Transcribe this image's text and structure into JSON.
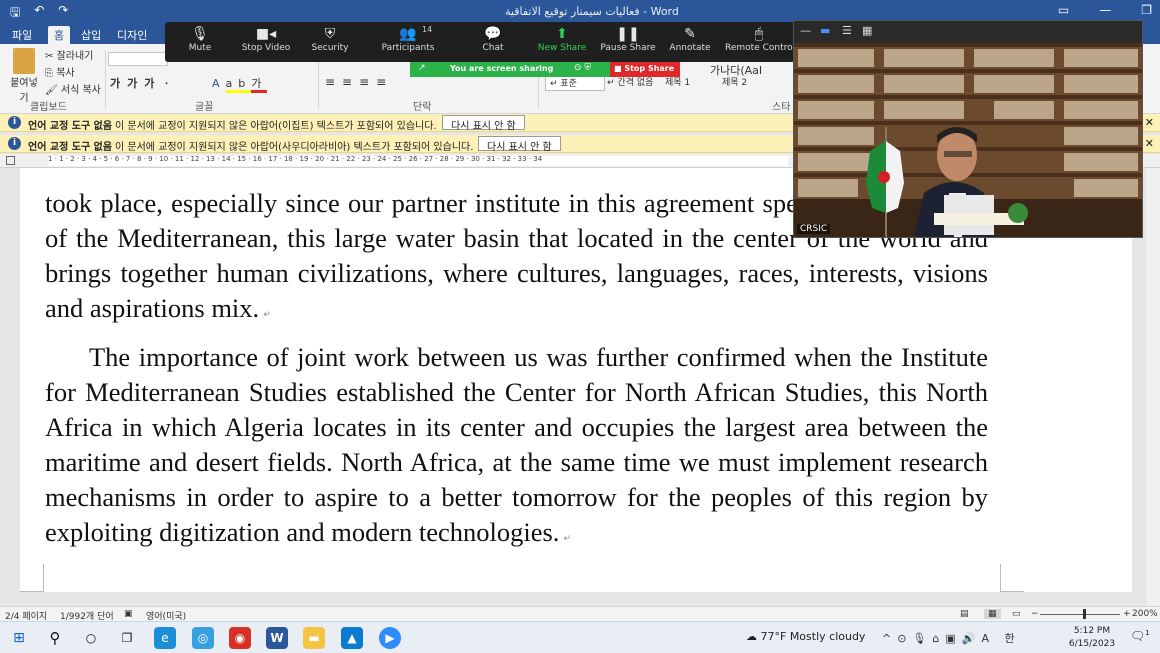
{
  "titlebar": {
    "doc_title": "فعاليات سيمنار توقيع الاتفاقية - Word"
  },
  "ribbon_tabs": [
    {
      "label": "파일"
    },
    {
      "label": "홈"
    },
    {
      "label": "삽입"
    },
    {
      "label": "디자인"
    }
  ],
  "ribbon": {
    "clipboard": {
      "paste": "붙여넣기",
      "cut": "잘라내기",
      "copy": "복사",
      "format_painter": "서식 복사",
      "group": "클립보드"
    },
    "font_group": "글꼴",
    "paragraph_group": "단락",
    "styles": {
      "sample": "가나다(AaI",
      "heading1": "제목 1",
      "heading2": "제목 2",
      "standard": "↵ 표준",
      "no_spacing": "↵ 간격 없음",
      "group": "스타"
    }
  },
  "infobars": [
    {
      "bold": "언어 교정 도구 없음",
      "message": "이 문서에 교정이 지원되지 않은 아랍어(이집트) 텍스트가 포함되어 있습니다.",
      "button": "다시 표시 안 함"
    },
    {
      "bold": "언어 교정 도구 없음",
      "message": "이 문서에 교정이 지원되지 않은 아랍어(사우디아라비아) 텍스트가 포함되어 있습니다.",
      "button": "다시 표시 안 함"
    }
  ],
  "ruler": {
    "numbers": "1 · 1 · 2 · 3 · 4 · 5 · 6 · 7 · 8 · 9 · 10 · 11 · 12 · 13 · 14 · 15 · 16 · 17 · 18 · 19 · 20 · 21 · 22 · 23 · 24 · 25 · 26 · 27 · 28 · 29 · 30 · 31 · 32 · 33 · 34"
  },
  "document": {
    "paragraph1": "took place, especially since our partner institute in this agreement specializes in studies of the Mediterranean, this large water basin that located in the center of the world and brings together human civilizations, where cultures, languages, races, interests, visions and aspirations mix.",
    "paragraph2": "The importance of joint work between us was further confirmed when the Institute for Mediterranean Studies established the Center for North African Studies, this North Africa in which Algeria locates in its center and occupies the largest area between the maritime and desert fields. North Africa, at the same time we must implement research mechanisms in order to aspire to a better tomorrow for the peoples of this region by exploiting digitization and modern technologies."
  },
  "statusbar": {
    "page": "2/4 페이지",
    "words": "1/992개 단어",
    "language": "영어(미국)",
    "zoom": "200%",
    "zoom_level_percent": 200
  },
  "zoom_toolbar": {
    "items": [
      {
        "label": "Mute",
        "icon": "microphone-icon"
      },
      {
        "label": "Stop Video",
        "icon": "video-camera-icon"
      },
      {
        "label": "Security",
        "icon": "shield-icon"
      },
      {
        "label": "Participants",
        "icon": "people-icon"
      },
      {
        "label": "Chat",
        "icon": "chat-bubble-icon"
      },
      {
        "label": "New Share",
        "icon": "share-arrow-icon"
      },
      {
        "label": "Pause Share",
        "icon": "pause-icon"
      },
      {
        "label": "Annotate",
        "icon": "pencil-icon"
      },
      {
        "label": "Remote Control",
        "icon": "mouse-icon"
      }
    ],
    "participant_count": "14",
    "sharing_status": "You are screen sharing",
    "stop_share": "Stop Share"
  },
  "video": {
    "participant_name": "CRSIC"
  },
  "taskbar": {
    "weather": "77°F  Mostly cloudy",
    "ime": "A  한",
    "time": "5:12 PM",
    "date": "6/15/2023",
    "notification_count": "1"
  },
  "colors": {
    "word_blue": "#2b579a",
    "share_green": "#2bb34a",
    "stop_red": "#e02828",
    "infobar_yellow": "#fdf1b8"
  }
}
